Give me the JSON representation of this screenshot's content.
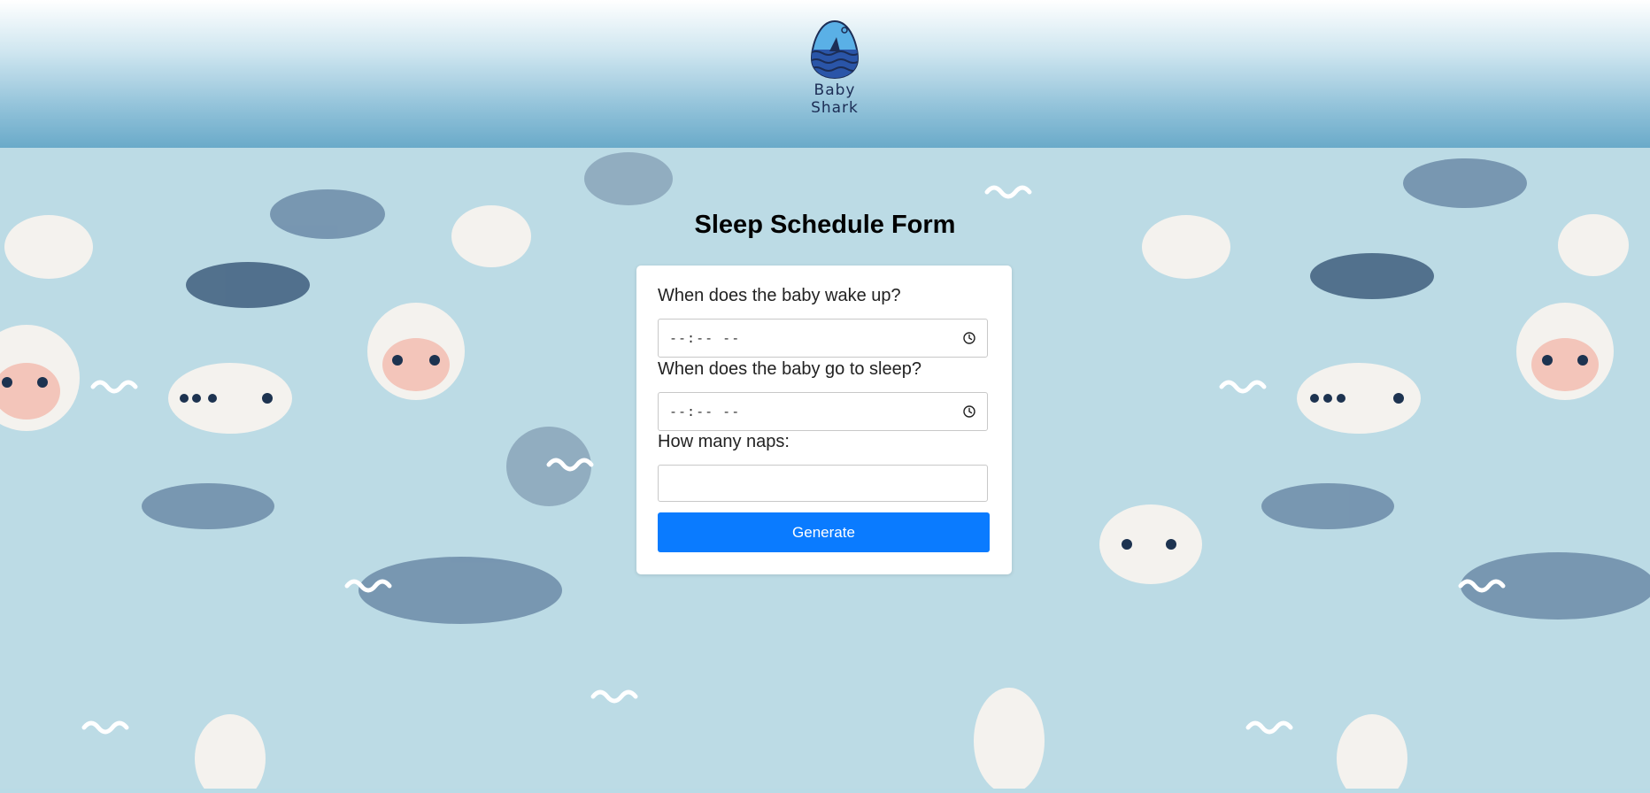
{
  "header": {
    "logo_text": "Baby Shark"
  },
  "form": {
    "title": "Sleep Schedule Form",
    "wake_label": "When does the baby wake up?",
    "wake_value": "--:-- --",
    "sleep_label": "When does the baby go to sleep?",
    "sleep_value": "--:-- --",
    "naps_label": "How many naps:",
    "naps_value": "",
    "generate_label": "Generate"
  },
  "colors": {
    "accent": "#0a7bff",
    "background": "#bcdbe5",
    "header_gradient_bottom": "#6aaac9"
  },
  "icons": {
    "logo": "shark-egg-logo",
    "time_picker": "clock-icon"
  }
}
